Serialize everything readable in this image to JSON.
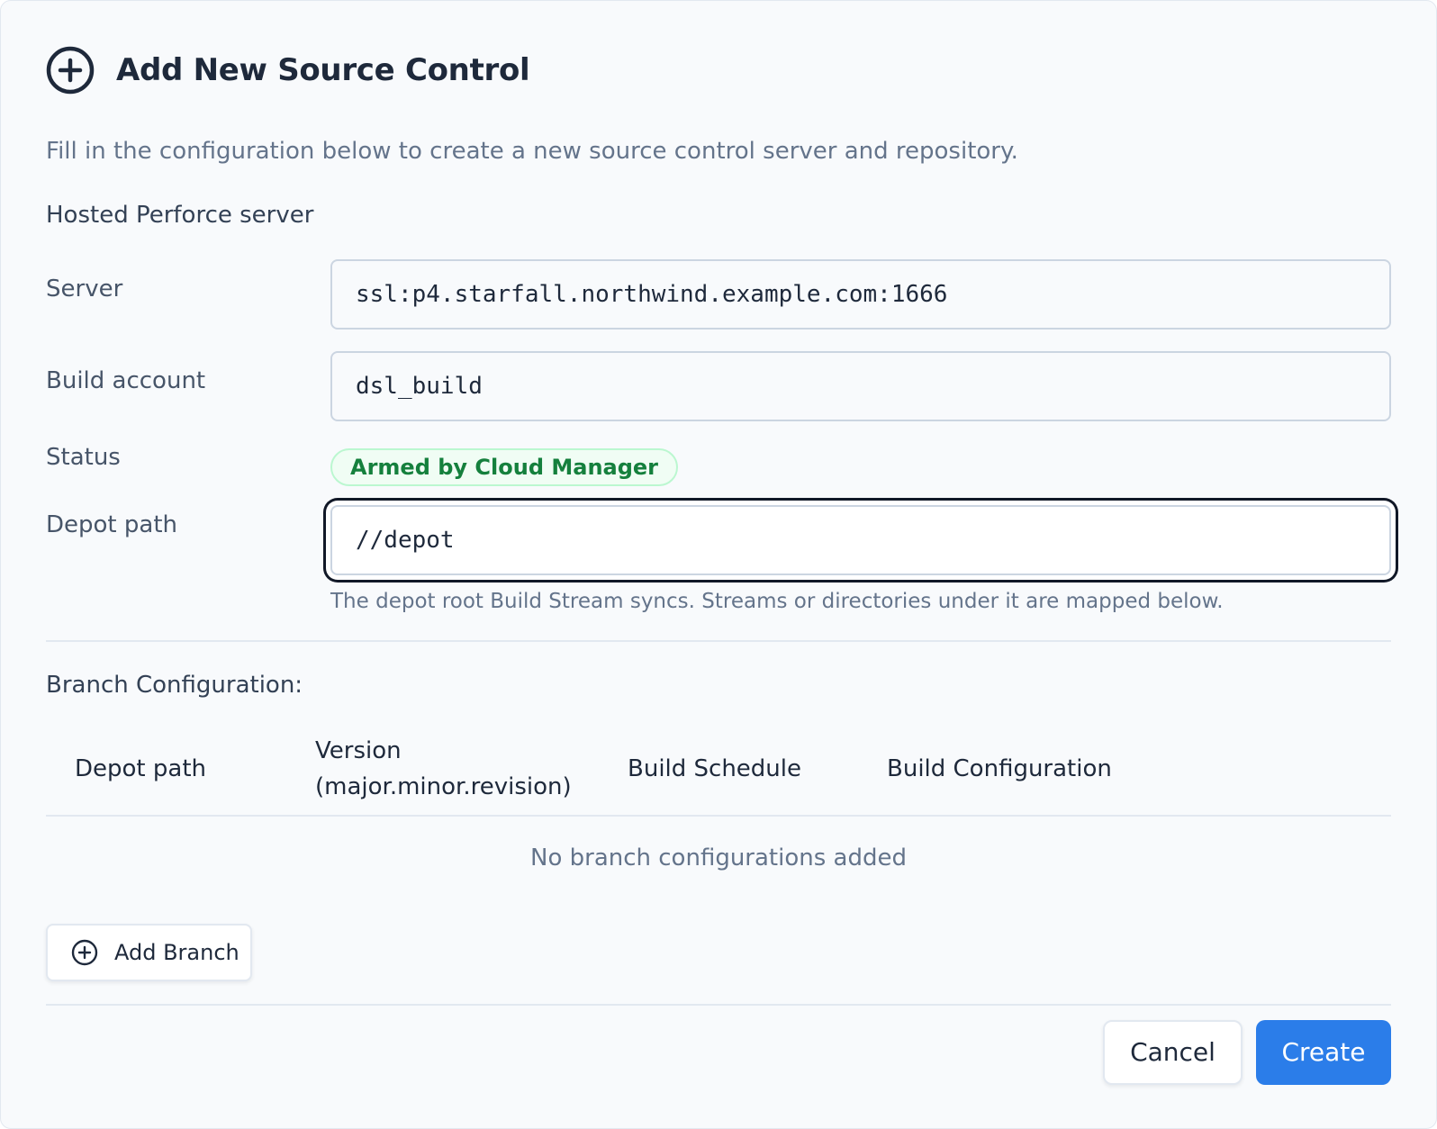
{
  "dialog": {
    "title": "Add New Source Control",
    "title_icon": "plus-circle-icon",
    "subtitle": "Fill in the configuration below to create a new source control server and repository.",
    "section_label": "Hosted Perforce server"
  },
  "fields": {
    "server": {
      "label": "Server",
      "value": "ssl:p4.starfall.northwind.example.com:1666"
    },
    "build_account": {
      "label": "Build account",
      "value": "dsl_build"
    },
    "status": {
      "label": "Status",
      "badge": "Armed by Cloud Manager",
      "badge_color": "#15803d"
    },
    "depot_path": {
      "label": "Depot path",
      "value": "//depot",
      "helper": "The depot root Build Stream syncs. Streams or directories under it are mapped below."
    }
  },
  "branch_config": {
    "heading": "Branch Configuration:",
    "columns": {
      "depot_path": "Depot path",
      "version_line1": "Version",
      "version_line2": "(major.minor.revision)",
      "build_schedule": "Build Schedule",
      "build_configuration": "Build Configuration"
    },
    "rows": [],
    "empty_message": "No branch configurations added",
    "add_button": {
      "label": "Add Branch",
      "icon": "plus-circle-icon"
    }
  },
  "footer": {
    "cancel_label": "Cancel",
    "create_label": "Create",
    "create_color": "#2b7de9"
  }
}
